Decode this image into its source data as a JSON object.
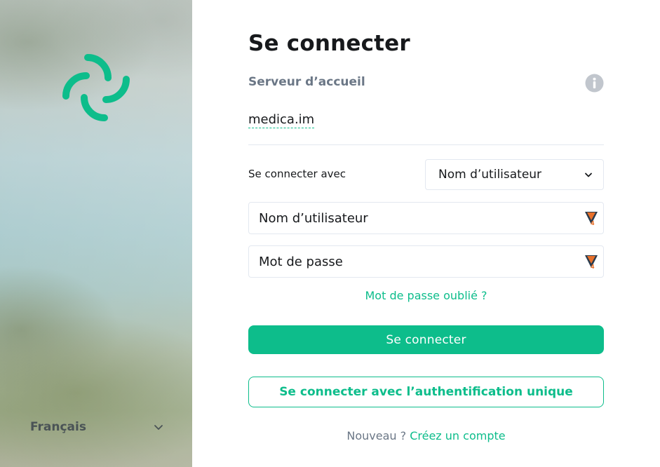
{
  "branding": {
    "logo_icon": "element-logo-icon",
    "accent_color": "#0dbd8b"
  },
  "language": {
    "selected": "Français",
    "icon": "chevron-down-icon"
  },
  "login": {
    "title": "Se connecter",
    "homeserver_label": "Serveur d’accueil",
    "info_icon": "info-icon",
    "server_name": "medica.im",
    "login_with_label": "Se connecter avec",
    "login_type_selected": "Nom d’utilisateur",
    "username_placeholder": "Nom d’utilisateur",
    "password_placeholder": "Mot de passe",
    "forgot_password": "Mot de passe oublié ?",
    "submit_label": "Se connecter",
    "sso_label": "Se connecter avec l’authentification unique",
    "new_user_text": "Nouveau ?",
    "create_account_link": "Créez un compte"
  }
}
